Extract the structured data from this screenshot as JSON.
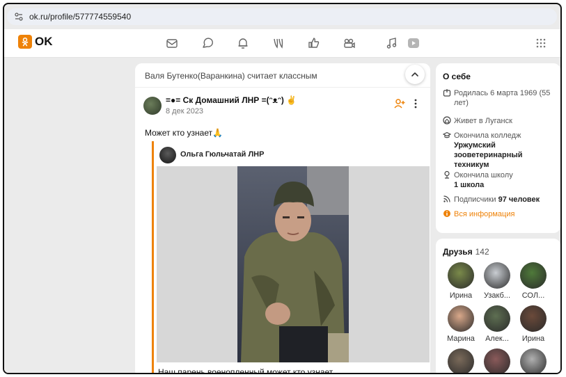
{
  "browser": {
    "url": "ok.ru/profile/577774559540"
  },
  "brand": {
    "logo_text": "OK",
    "accent": "#ee8208"
  },
  "nav": {
    "icons": [
      "mail-icon",
      "discussions-icon",
      "notifications-icon",
      "guests-icon",
      "likes-icon",
      "video-chat-icon",
      "music-icon",
      "video-icon"
    ]
  },
  "feed": {
    "header": "Валя Бутенко(Варанкина) считает классным",
    "post": {
      "author": "=●= Ск Домашний ЛНР =(ᵔᴥᵔ) ✌",
      "date": "8 дек 2023",
      "text": "Может кто узнает🙏",
      "reshare": {
        "author": "Ольга Гюльчатай ЛНР",
        "caption": "Наш парень военопленный,может кто узнает..."
      }
    }
  },
  "about": {
    "title": "О себе",
    "born": "Родилась 6 марта 1969 (55 лет)",
    "lives": "Живет в Луганск",
    "college_prefix": "Окончила колледж",
    "college": "Уржумский зооветеринарный техникум",
    "school_prefix": "Окончила школу",
    "school": "1 школа",
    "subscribers_prefix": "Подписчики",
    "subscribers": "97 человек",
    "all_info": "Вся информация"
  },
  "friends": {
    "title": "Друзья",
    "count": "142",
    "items": [
      {
        "name": "Ирина",
        "color": "#7a8a4a"
      },
      {
        "name": "Узакб...",
        "color": "#c9cdd2"
      },
      {
        "name": "СОЛ...",
        "color": "#4f7a3a"
      },
      {
        "name": "Марина",
        "color": "#d9a88a"
      },
      {
        "name": "Алек...",
        "color": "#5e6f52"
      },
      {
        "name": "Ирина",
        "color": "#6b4a3a"
      },
      {
        "name": "",
        "color": "#7a6a5a"
      },
      {
        "name": "",
        "color": "#8a5a5a"
      },
      {
        "name": "",
        "color": "#b0b0b0"
      }
    ]
  }
}
